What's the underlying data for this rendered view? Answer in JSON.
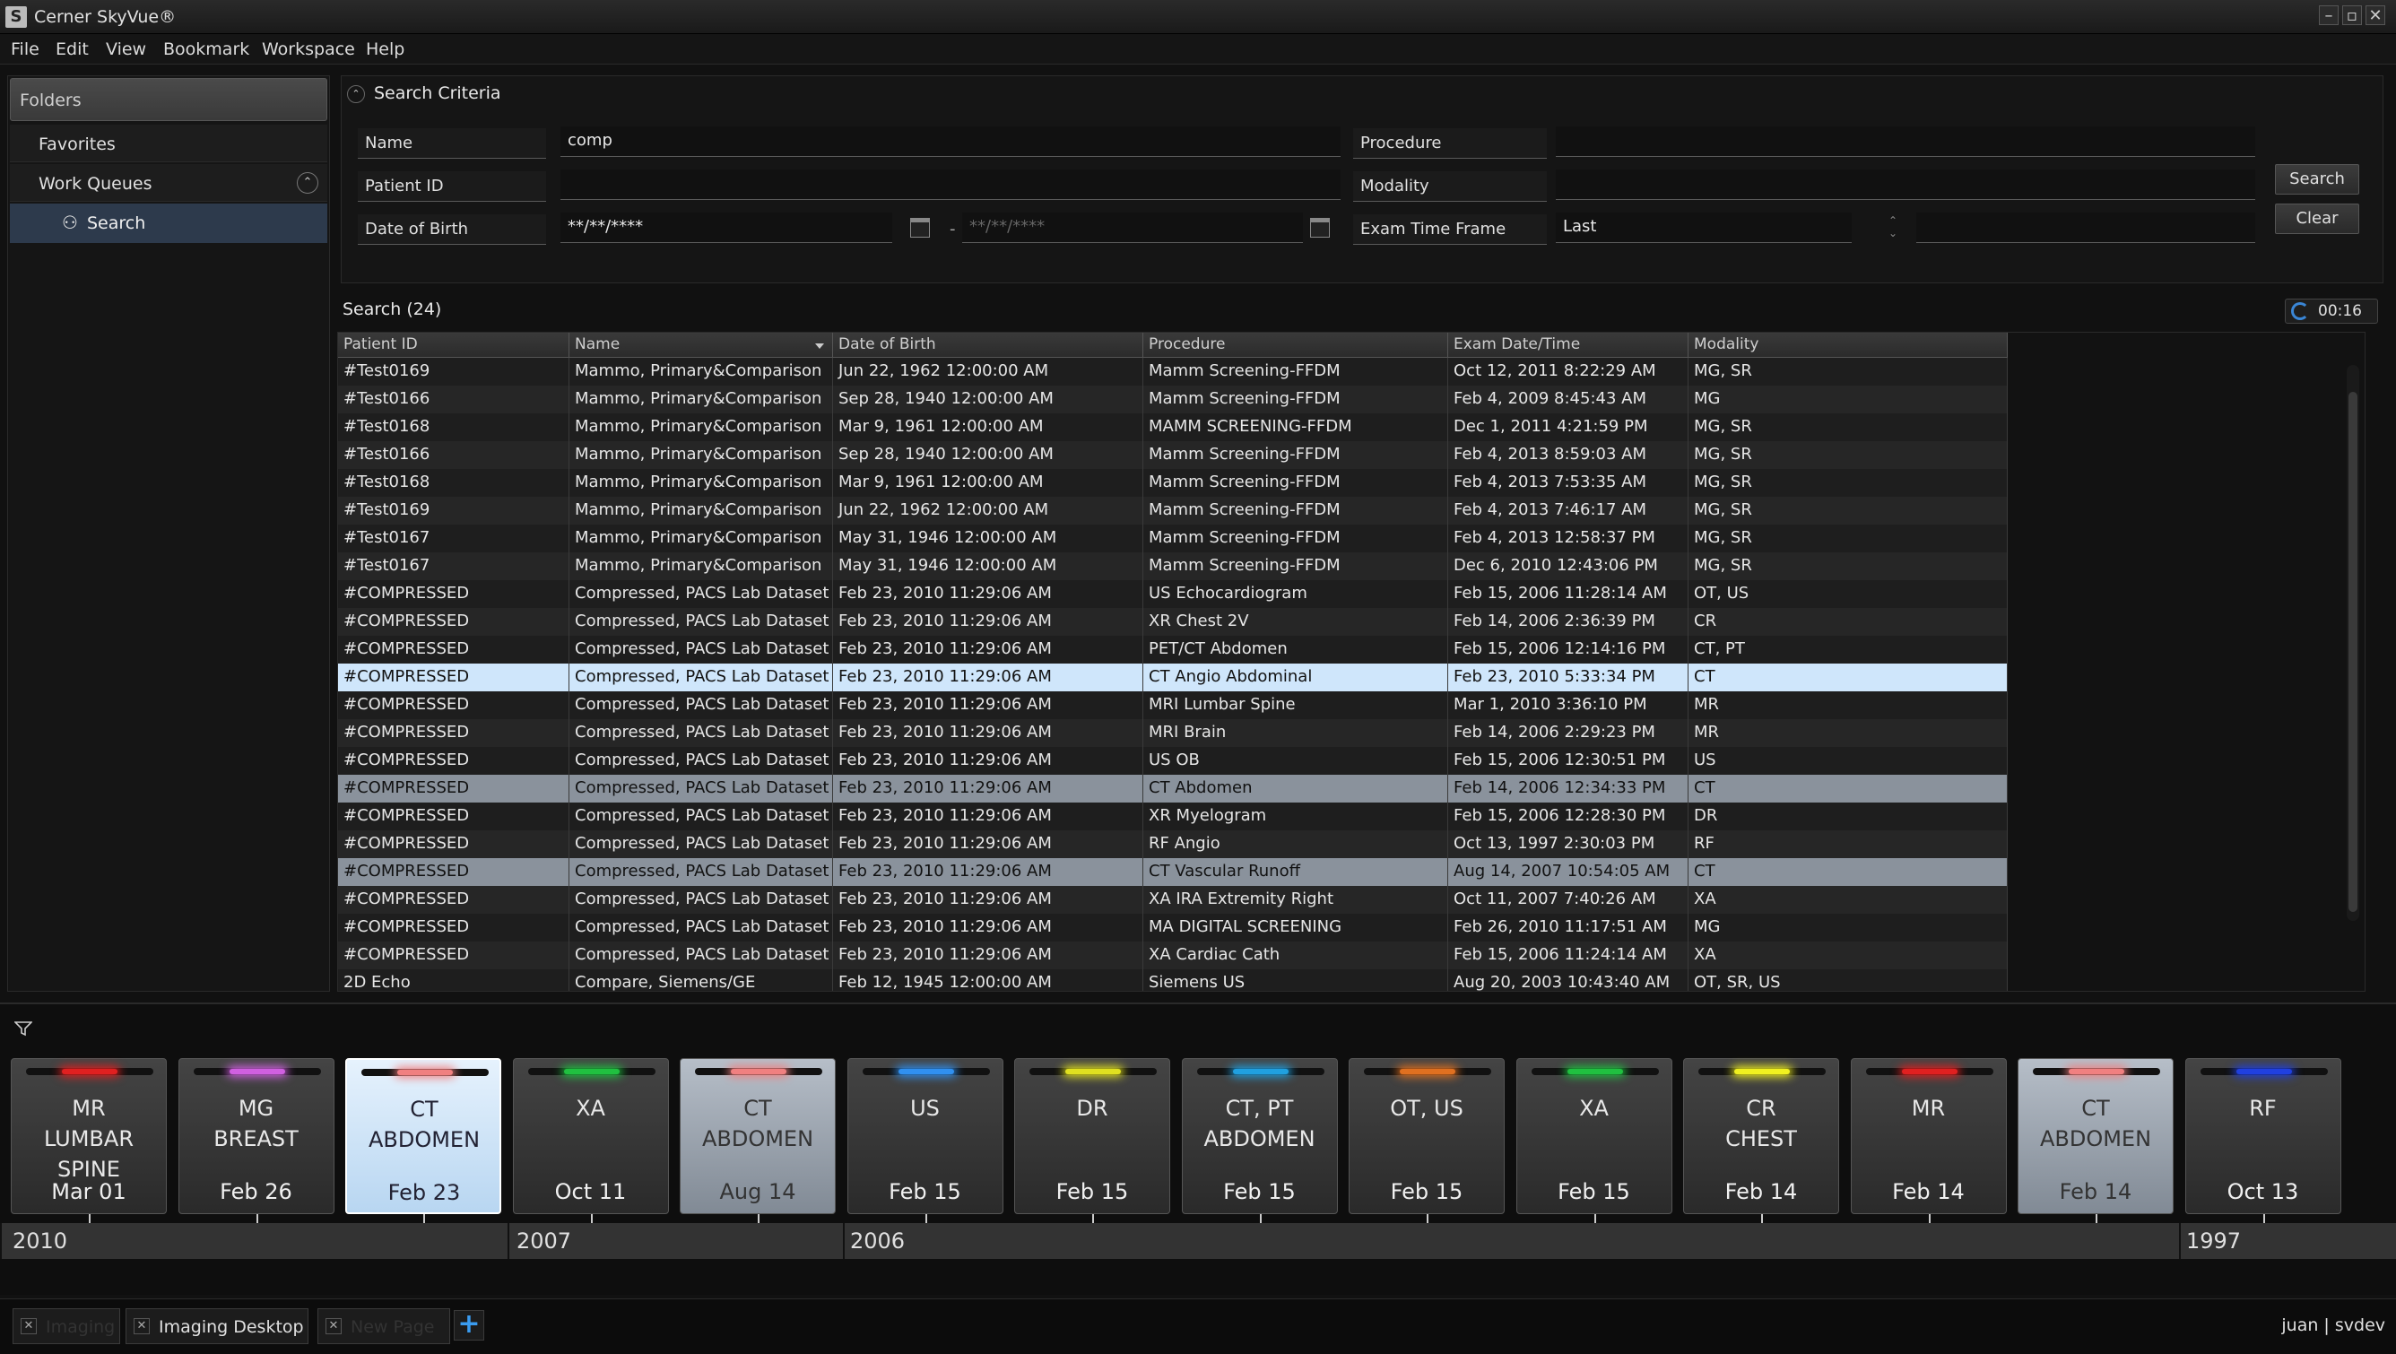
{
  "app": {
    "title": "Cerner SkyVue®",
    "logo_letter": "S"
  },
  "window_controls": [
    "–",
    "▫",
    "✕"
  ],
  "menu": [
    "File",
    "Edit",
    "View",
    "Bookmark",
    "Workspace",
    "Help"
  ],
  "sidebar": {
    "header": "Folders",
    "favorites": "Favorites",
    "work_queues": "Work Queues",
    "search": "Search"
  },
  "criteria": {
    "title": "Search Criteria",
    "name_label": "Name",
    "name_value": "comp",
    "patient_id_label": "Patient ID",
    "dob_label": "Date of Birth",
    "dob_from_placeholder": "**/**/****",
    "dob_to_placeholder": "**/**/****",
    "dob_separator": "-",
    "procedure_label": "Procedure",
    "modality_label": "Modality",
    "exam_time_label": "Exam Time Frame",
    "last_label": "Last",
    "search_button": "Search",
    "clear_button": "Clear"
  },
  "results": {
    "title": "Search (24)",
    "timer": "00:16",
    "columns": [
      "Patient ID",
      "Name",
      "Date of Birth",
      "Procedure",
      "Exam Date/Time",
      "Modality"
    ],
    "rows": [
      {
        "pid": "#Test0169",
        "name": "Mammo, Primary&Comparison",
        "dob": "Jun 22, 1962 12:00:00 AM",
        "proc": "Mamm Screening-FFDM",
        "exam": "Oct 12, 2011 8:22:29 AM",
        "mod": "MG, SR"
      },
      {
        "pid": "#Test0166",
        "name": "Mammo, Primary&Comparison",
        "dob": "Sep 28, 1940 12:00:00 AM",
        "proc": "Mamm Screening-FFDM",
        "exam": "Feb 4, 2009 8:45:43 AM",
        "mod": "MG"
      },
      {
        "pid": "#Test0168",
        "name": "Mammo, Primary&Comparison",
        "dob": "Mar 9, 1961 12:00:00 AM",
        "proc": "MAMM SCREENING-FFDM",
        "exam": "Dec 1, 2011 4:21:59 PM",
        "mod": "MG, SR"
      },
      {
        "pid": "#Test0166",
        "name": "Mammo, Primary&Comparison",
        "dob": "Sep 28, 1940 12:00:00 AM",
        "proc": "Mamm Screening-FFDM",
        "exam": "Feb 4, 2013 8:59:03 AM",
        "mod": "MG, SR"
      },
      {
        "pid": "#Test0168",
        "name": "Mammo, Primary&Comparison",
        "dob": "Mar 9, 1961 12:00:00 AM",
        "proc": "Mamm Screening-FFDM",
        "exam": "Feb 4, 2013 7:53:35 AM",
        "mod": "MG, SR"
      },
      {
        "pid": "#Test0169",
        "name": "Mammo, Primary&Comparison",
        "dob": "Jun 22, 1962 12:00:00 AM",
        "proc": "Mamm Screening-FFDM",
        "exam": "Feb 4, 2013 7:46:17 AM",
        "mod": "MG, SR"
      },
      {
        "pid": "#Test0167",
        "name": "Mammo, Primary&Comparison",
        "dob": "May 31, 1946 12:00:00 AM",
        "proc": "Mamm Screening-FFDM",
        "exam": "Feb 4, 2013 12:58:37 PM",
        "mod": "MG, SR"
      },
      {
        "pid": "#Test0167",
        "name": "Mammo, Primary&Comparison",
        "dob": "May 31, 1946 12:00:00 AM",
        "proc": "Mamm Screening-FFDM",
        "exam": "Dec 6, 2010 12:43:06 PM",
        "mod": "MG, SR"
      },
      {
        "pid": "#COMPRESSED",
        "name": "Compressed, PACS Lab Dataset",
        "dob": "Feb 23, 2010 11:29:06 AM",
        "proc": "US Echocardiogram",
        "exam": "Feb 15, 2006 11:28:14 AM",
        "mod": "OT, US"
      },
      {
        "pid": "#COMPRESSED",
        "name": "Compressed, PACS Lab Dataset",
        "dob": "Feb 23, 2010 11:29:06 AM",
        "proc": "XR Chest 2V",
        "exam": "Feb 14, 2006 2:36:39 PM",
        "mod": "CR"
      },
      {
        "pid": "#COMPRESSED",
        "name": "Compressed, PACS Lab Dataset",
        "dob": "Feb 23, 2010 11:29:06 AM",
        "proc": "PET/CT Abdomen",
        "exam": "Feb 15, 2006 12:14:16 PM",
        "mod": "CT, PT"
      },
      {
        "pid": "#COMPRESSED",
        "name": "Compressed, PACS Lab Dataset",
        "dob": "Feb 23, 2010 11:29:06 AM",
        "proc": "CT Angio Abdominal",
        "exam": "Feb 23, 2010 5:33:34 PM",
        "mod": "CT",
        "state": "sel"
      },
      {
        "pid": "#COMPRESSED",
        "name": "Compressed, PACS Lab Dataset",
        "dob": "Feb 23, 2010 11:29:06 AM",
        "proc": "MRI Lumbar Spine",
        "exam": "Mar 1, 2010 3:36:10 PM",
        "mod": "MR"
      },
      {
        "pid": "#COMPRESSED",
        "name": "Compressed, PACS Lab Dataset",
        "dob": "Feb 23, 2010 11:29:06 AM",
        "proc": "MRI Brain",
        "exam": "Feb 14, 2006 2:29:23 PM",
        "mod": "MR"
      },
      {
        "pid": "#COMPRESSED",
        "name": "Compressed, PACS Lab Dataset",
        "dob": "Feb 23, 2010 11:29:06 AM",
        "proc": "US OB",
        "exam": "Feb 15, 2006 12:30:51 PM",
        "mod": "US"
      },
      {
        "pid": "#COMPRESSED",
        "name": "Compressed, PACS Lab Dataset",
        "dob": "Feb 23, 2010 11:29:06 AM",
        "proc": "CT Abdomen",
        "exam": "Feb 14, 2006 12:34:33 PM",
        "mod": "CT",
        "state": "sel2"
      },
      {
        "pid": "#COMPRESSED",
        "name": "Compressed, PACS Lab Dataset",
        "dob": "Feb 23, 2010 11:29:06 AM",
        "proc": "XR Myelogram",
        "exam": "Feb 15, 2006 12:28:30 PM",
        "mod": "DR"
      },
      {
        "pid": "#COMPRESSED",
        "name": "Compressed, PACS Lab Dataset",
        "dob": "Feb 23, 2010 11:29:06 AM",
        "proc": "RF Angio",
        "exam": "Oct 13, 1997 2:30:03 PM",
        "mod": "RF"
      },
      {
        "pid": "#COMPRESSED",
        "name": "Compressed, PACS Lab Dataset",
        "dob": "Feb 23, 2010 11:29:06 AM",
        "proc": "CT Vascular Runoff",
        "exam": "Aug 14, 2007 10:54:05 AM",
        "mod": "CT",
        "state": "sel2"
      },
      {
        "pid": "#COMPRESSED",
        "name": "Compressed, PACS Lab Dataset",
        "dob": "Feb 23, 2010 11:29:06 AM",
        "proc": "XA IRA Extremity Right",
        "exam": "Oct 11, 2007 7:40:26 AM",
        "mod": "XA"
      },
      {
        "pid": "#COMPRESSED",
        "name": "Compressed, PACS Lab Dataset",
        "dob": "Feb 23, 2010 11:29:06 AM",
        "proc": "MA DIGITAL SCREENING",
        "exam": "Feb 26, 2010 11:17:51 AM",
        "mod": "MG"
      },
      {
        "pid": "#COMPRESSED",
        "name": "Compressed, PACS Lab Dataset",
        "dob": "Feb 23, 2010 11:29:06 AM",
        "proc": "XA Cardiac Cath",
        "exam": "Feb 15, 2006 11:24:14 AM",
        "mod": "XA"
      },
      {
        "pid": "2D Echo",
        "name": "Compare, Siemens/GE",
        "dob": "Feb 12, 1945 12:00:00 AM",
        "proc": "Siemens US",
        "exam": "Aug 20, 2003 10:43:40 AM",
        "mod": "OT, SR, US"
      }
    ]
  },
  "timeline": {
    "cards": [
      {
        "mod": "MR\nLUMBAR SPINE",
        "date": "Mar 01",
        "color": "#e02020",
        "state": ""
      },
      {
        "mod": "MG\nBREAST",
        "date": "Feb 26",
        "color": "#d060e0",
        "state": ""
      },
      {
        "mod": "CT\nABDOMEN",
        "date": "Feb 23",
        "color": "#f08080",
        "state": "lightsel"
      },
      {
        "mod": "XA",
        "date": "Oct 11",
        "color": "#20c040",
        "state": ""
      },
      {
        "mod": "CT\nABDOMEN",
        "date": "Aug 14",
        "color": "#f08080",
        "state": "greysel"
      },
      {
        "mod": "US",
        "date": "Feb 15",
        "color": "#3090f0",
        "state": ""
      },
      {
        "mod": "DR",
        "date": "Feb 15",
        "color": "#e0e020",
        "state": ""
      },
      {
        "mod": "CT, PT\nABDOMEN",
        "date": "Feb 15",
        "color": "#20a0e0",
        "state": ""
      },
      {
        "mod": "OT, US",
        "date": "Feb 15",
        "color": "#e07020",
        "state": ""
      },
      {
        "mod": "XA",
        "date": "Feb 15",
        "color": "#20c040",
        "state": ""
      },
      {
        "mod": "CR\nCHEST",
        "date": "Feb 14",
        "color": "#f0f020",
        "state": ""
      },
      {
        "mod": "MR",
        "date": "Feb 14",
        "color": "#e02020",
        "state": ""
      },
      {
        "mod": "CT\nABDOMEN",
        "date": "Feb 14",
        "color": "#f08080",
        "state": "greysel"
      },
      {
        "mod": "RF",
        "date": "Oct 13",
        "color": "#2040e0",
        "state": ""
      }
    ],
    "years": [
      "2010",
      "2007",
      "2006",
      "1997"
    ]
  },
  "tabs": [
    {
      "label": "Imaging",
      "dim": true
    },
    {
      "label": "Imaging Desktop",
      "dim": false
    },
    {
      "label": "New Page",
      "dim": true
    }
  ],
  "add_tab": "+",
  "user": "juan | svdev"
}
